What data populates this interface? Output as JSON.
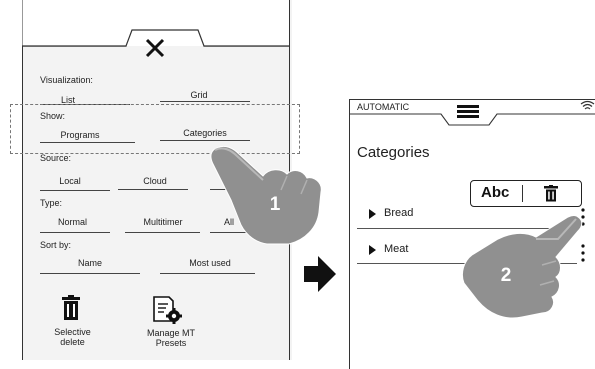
{
  "left_panel": {
    "visualization": {
      "label": "Visualization:",
      "options": [
        "List",
        "Grid"
      ]
    },
    "show": {
      "label": "Show:",
      "options": [
        "Programs",
        "Categories"
      ]
    },
    "source": {
      "label": "Source:",
      "options": [
        "Local",
        "Cloud"
      ]
    },
    "type": {
      "label": "Type:",
      "options": [
        "Normal",
        "Multitimer",
        "All"
      ]
    },
    "sort_by": {
      "label": "Sort by:",
      "options": [
        "Name",
        "Most used"
      ]
    },
    "actions": [
      {
        "label_line1": "Selective",
        "label_line2": "delete",
        "icon": "trash-icon"
      },
      {
        "label_line1": "Manage MT",
        "label_line2": "Presets",
        "icon": "document-gear-icon"
      }
    ],
    "close_icon": "close-icon"
  },
  "right_panel": {
    "mode": "AUTOMATIC",
    "title": "Categories",
    "popup": {
      "text": "Abc"
    },
    "items": [
      "Bread",
      "Meat"
    ]
  },
  "steps": [
    "1",
    "2"
  ]
}
